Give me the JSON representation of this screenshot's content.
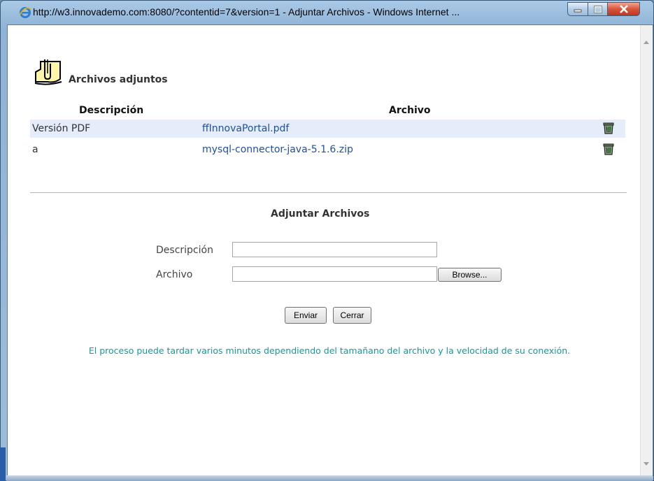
{
  "window": {
    "title": "http://w3.innovademo.com:8080/?contentid=7&version=1 - Adjuntar Archivos - Windows Internet ...",
    "controls": {
      "minimize": "minimize-icon",
      "maximize": "maximize-icon",
      "close": "close-icon"
    }
  },
  "attachments": {
    "title": "Archivos adjuntos",
    "columns": {
      "description": "Descripción",
      "file": "Archivo"
    },
    "rows": [
      {
        "description": "Versión PDF",
        "file": "ffInnovaPortal.pdf",
        "icon": "trash-icon"
      },
      {
        "description": "a",
        "file": "mysql-connector-java-5.1.6.zip",
        "icon": "trash-icon"
      }
    ]
  },
  "form": {
    "title": "Adjuntar Archivos",
    "description_label": "Descripción",
    "description_value": "",
    "file_label": "Archivo",
    "file_value": "",
    "browse_label": "Browse...",
    "send_label": "Enviar",
    "close_label": "Cerrar"
  },
  "note": "El proceso puede tardar varios minutos dependiendo del tamañano del archivo y la velocidad de su conexión.",
  "colors": {
    "row_alt": "#e4edf9",
    "link": "#1f4f9f",
    "note": "#129a9a",
    "close_button": "#c1361d"
  }
}
